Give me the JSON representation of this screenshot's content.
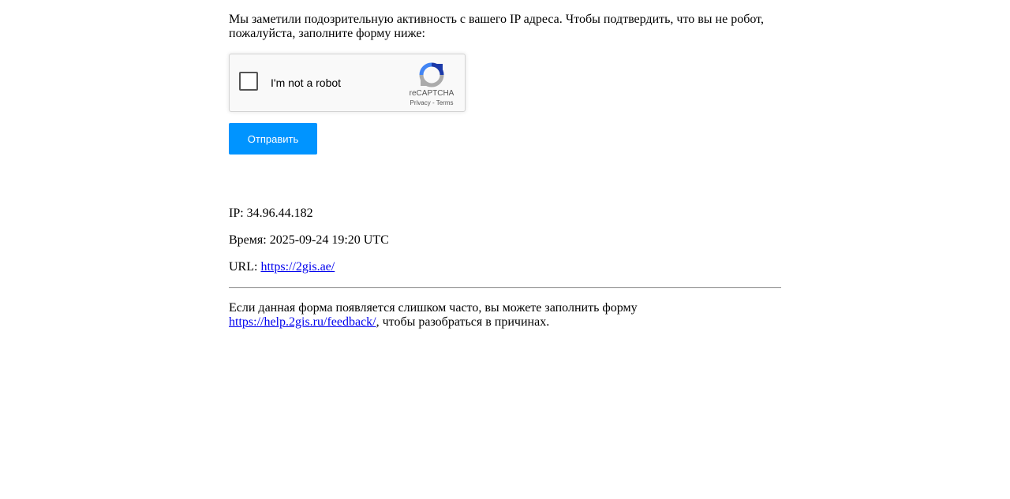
{
  "intro_text": "Мы заметили подозрительную активность с вашего IP адреса. Чтобы подтвердить, что вы не робот, пожалуйста, заполните форму ниже:",
  "recaptcha": {
    "checkbox_label": "I'm not a robot",
    "brand": "reCAPTCHA",
    "privacy_link": "Privacy",
    "separator": " - ",
    "terms_link": "Terms",
    "checked": false,
    "icon": "recaptcha-logo-icon"
  },
  "submit_label": "Отправить",
  "colors": {
    "button_bg": "#0094ff",
    "link": "#0000ee"
  },
  "info": {
    "ip_label": "IP: ",
    "ip_value": "34.96.44.182",
    "time_label": "Время: ",
    "time_value": "2025-09-24 19:20 UTC",
    "url_label": "URL: ",
    "url_value": "https://2gis.ae/"
  },
  "footer": {
    "text_before": "Если данная форма появляется слишком часто, вы можете заполнить форму ",
    "link_text": "https://help.2gis.ru/feedback/",
    "text_after": ", чтобы разобраться в причинах."
  }
}
